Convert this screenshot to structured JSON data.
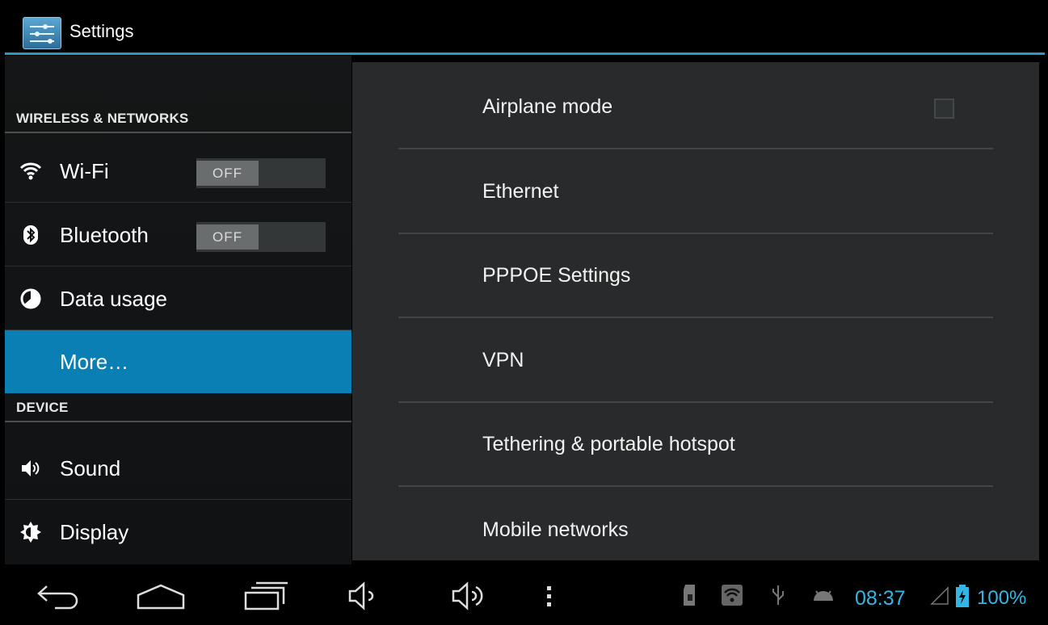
{
  "app": {
    "title": "Settings",
    "icon": "settings-sliders-icon"
  },
  "sidebar": {
    "headers": {
      "wireless": "WIRELESS & NETWORKS",
      "device": "DEVICE"
    },
    "items": [
      {
        "label": "Wi-Fi",
        "icon": "wifi-icon",
        "toggle": "OFF"
      },
      {
        "label": "Bluetooth",
        "icon": "bluetooth-icon",
        "toggle": "OFF"
      },
      {
        "label": "Data usage",
        "icon": "data-usage-icon"
      },
      {
        "label": "More…",
        "selected": true
      },
      {
        "label": "Sound",
        "icon": "speaker-icon"
      },
      {
        "label": "Display",
        "icon": "display-brightness-icon"
      }
    ]
  },
  "content": {
    "items": [
      {
        "label": "Airplane mode",
        "checkbox": false
      },
      {
        "label": "Ethernet"
      },
      {
        "label": "PPPOE Settings"
      },
      {
        "label": "VPN"
      },
      {
        "label": "Tethering & portable hotspot"
      },
      {
        "label": "Mobile networks"
      }
    ]
  },
  "navbar": {
    "buttons": [
      "back-icon",
      "home-icon",
      "recent-apps-icon",
      "volume-down-icon",
      "volume-up-icon",
      "menu-icon"
    ],
    "status_icons": [
      "sd-card-icon",
      "wifi-status-icon",
      "usb-icon",
      "android-debug-icon",
      "signal-icon",
      "battery-icon"
    ],
    "time": "08:37",
    "battery": "100%"
  },
  "colors": {
    "accent": "#33b5e5",
    "selected": "#0a7fb4",
    "background": "#000000",
    "panel": "#282a2b"
  }
}
